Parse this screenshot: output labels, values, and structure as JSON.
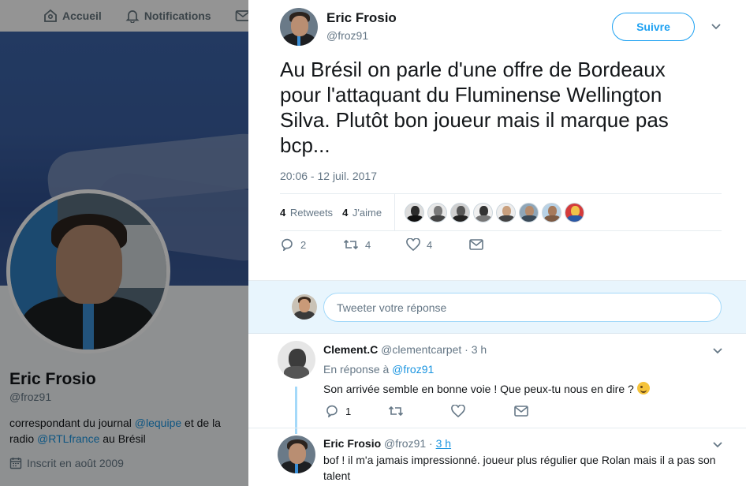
{
  "topnav": {
    "home_label": "Accueil",
    "notifications_label": "Notifications"
  },
  "profile": {
    "name": "Eric Frosio",
    "handle": "@froz91",
    "bio_prefix": "correspondant du journal ",
    "bio_link1": "@lequipe",
    "bio_middle": " et de la radio ",
    "bio_link2": "@RTLfrance",
    "bio_suffix": " au Brésil",
    "joined": "Inscrit en août 2009"
  },
  "tweet": {
    "author_name": "Eric Frosio",
    "author_handle": "@froz91",
    "follow_label": "Suivre",
    "text": "Au Brésil on parle d'une offre de Bordeaux pour l'attaquant du Fluminense Wellington Silva. Plutôt bon joueur mais il marque pas bcp...",
    "timestamp": "20:06 - 12 juil. 2017",
    "retweets_count": "4",
    "retweets_label": "Retweets",
    "likes_count": "4",
    "likes_label": "J'aime",
    "reply_count": "2",
    "retweet_action_count": "4",
    "like_action_count": "4"
  },
  "reply_box": {
    "placeholder": "Tweeter votre réponse"
  },
  "replies": [
    {
      "name": "Clement.C",
      "handle": "@clementcarpet",
      "separator": "·",
      "time": "3 h",
      "context_prefix": "En réponse à ",
      "context_link": "@froz91",
      "text": "Son arrivée semble en bonne voie ! Que peux-tu nous en dire ?",
      "reply_count": "1"
    },
    {
      "name": "Eric Frosio",
      "handle": "@froz91",
      "separator": "·",
      "time": "3 h",
      "text": "bof ! il m'a jamais impressionné. joueur plus régulier que Rolan mais il a pas son talent"
    }
  ],
  "colors": {
    "accent": "#1da1f2",
    "link": "#1b95e0",
    "text_primary": "#14171a",
    "text_secondary": "#657786",
    "reply_box_bg": "#e8f5fd"
  }
}
